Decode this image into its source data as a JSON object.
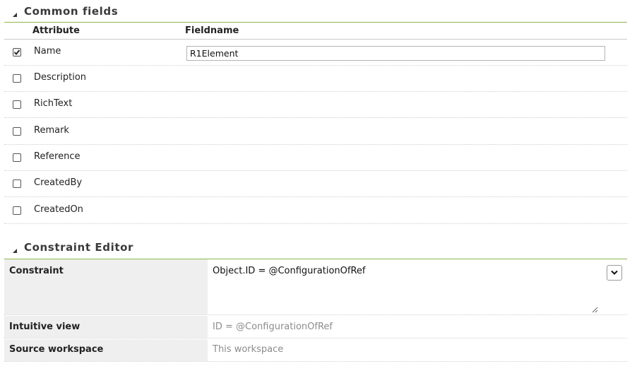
{
  "common_fields": {
    "title": "Common fields",
    "columns": {
      "attribute": "Attribute",
      "fieldname": "Fieldname"
    },
    "rows": [
      {
        "label": "Name",
        "checked": true,
        "fieldname": "R1Element"
      },
      {
        "label": "Description",
        "checked": false
      },
      {
        "label": "RichText",
        "checked": false
      },
      {
        "label": "Remark",
        "checked": false
      },
      {
        "label": "Reference",
        "checked": false
      },
      {
        "label": "CreatedBy",
        "checked": false
      },
      {
        "label": "CreatedOn",
        "checked": false
      }
    ]
  },
  "constraint_editor": {
    "title": "Constraint Editor",
    "constraint_label": "Constraint",
    "constraint_value": "Object.ID = @ConfigurationOfRef",
    "intuitive_view_label": "Intuitive view",
    "intuitive_view_value": "ID = @ConfigurationOfRef",
    "source_workspace_label": "Source workspace",
    "source_workspace_value": "This workspace"
  },
  "colors": {
    "accent_rule": "#8fb84a",
    "label_bg": "#efefef"
  },
  "icons": {
    "section_toggle": "collapse-triangle-icon",
    "checkbox_checked": "checkmark-icon",
    "dropdown": "chevron-down-icon",
    "resize": "resize-grip-icon"
  }
}
